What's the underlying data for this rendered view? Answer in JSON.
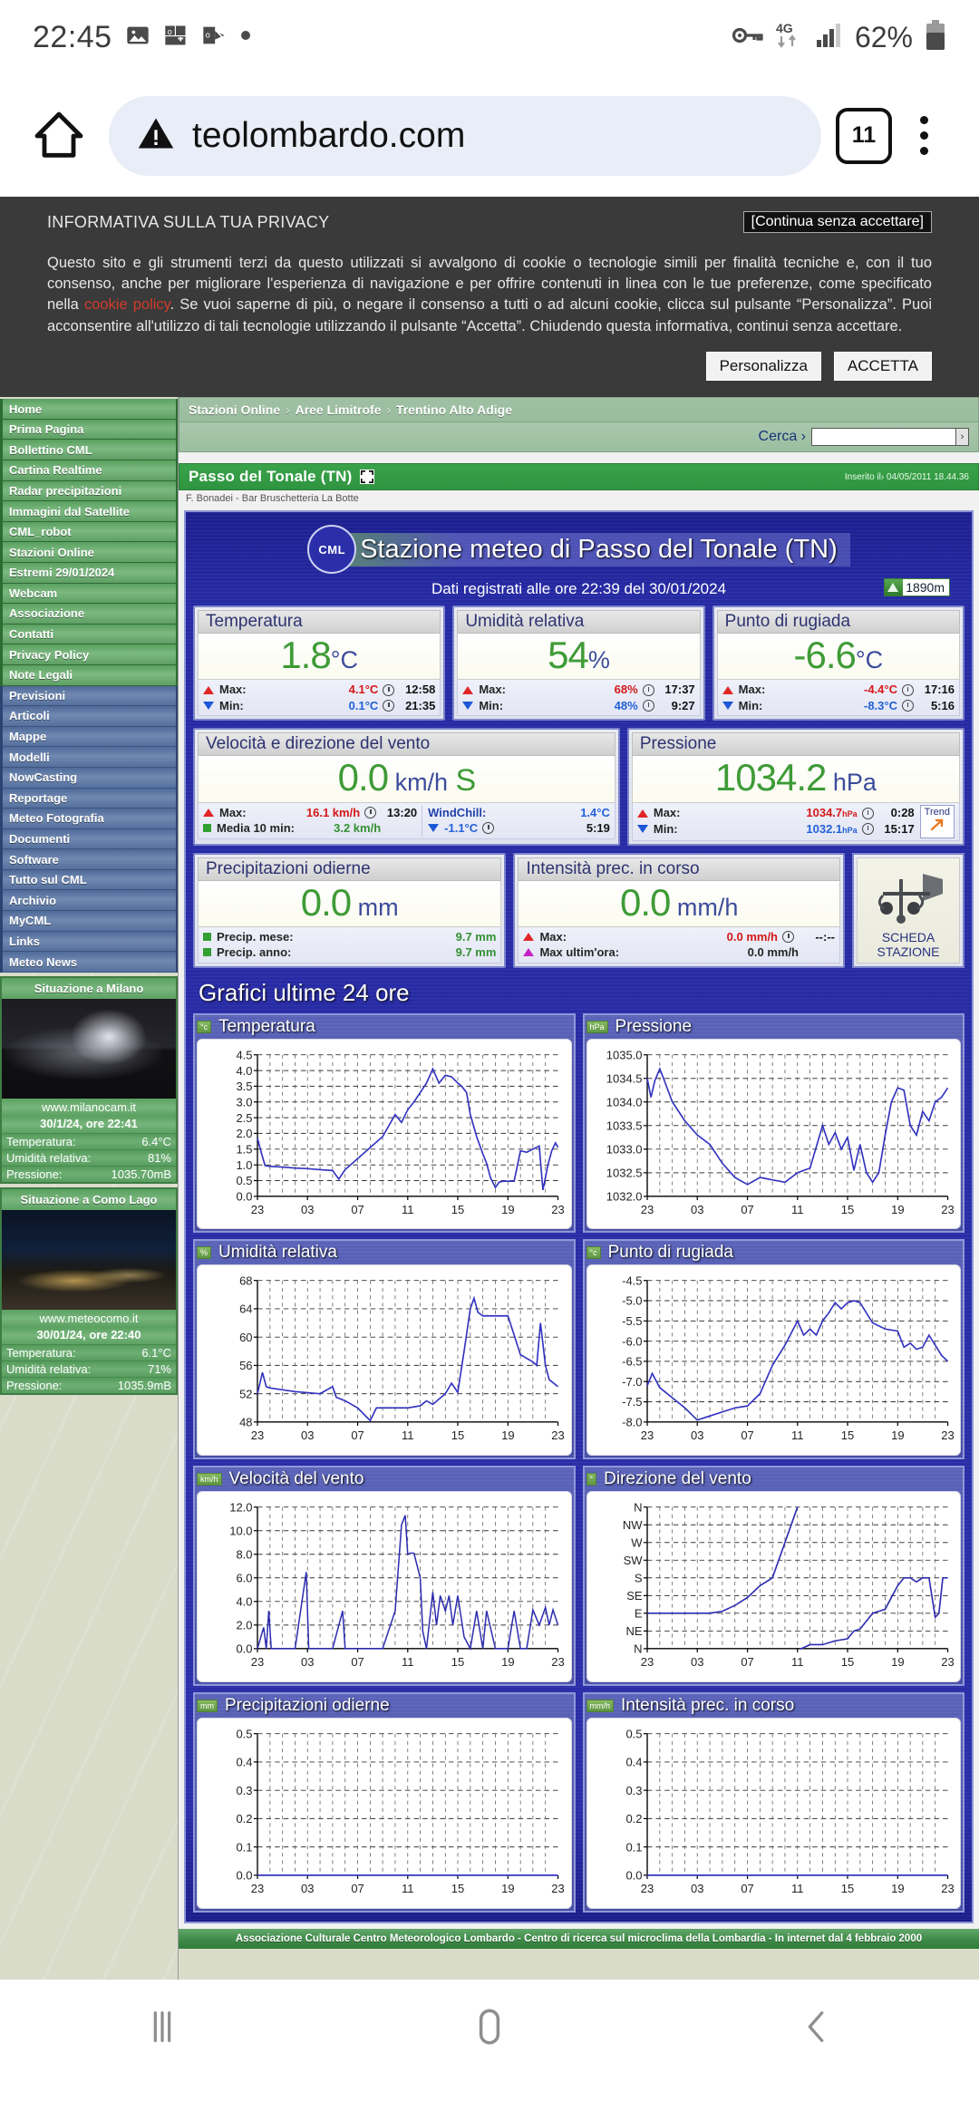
{
  "status_bar": {
    "time": "22:45",
    "icons": [
      "image-icon",
      "office-icon",
      "outlook-icon",
      "dot-icon"
    ],
    "right_icons": [
      "vpn-key-icon",
      "4g-data-icon",
      "signal-bars-icon"
    ],
    "battery_percent": "62%",
    "network_label": "4G"
  },
  "browser": {
    "home_icon": "home-icon",
    "security_icon": "not-secure-warning-icon",
    "url": "teolombardo.com",
    "tab_count": "11",
    "menu_icon": "overflow-menu-icon"
  },
  "privacy_banner": {
    "title": "INFORMATIVA SULLA TUA PRIVACY",
    "continue_button": "[Continua senza accettare]",
    "body_1": "Questo sito e gli strumenti terzi da questo utilizzati si avvalgono di cookie o tecnologie simili per finalità tecniche e, con il tuo consenso, anche per migliorare l'esperienza di navigazione e per offrire contenuti in linea con le tue preferenze, come specificato nella ",
    "policy_link": "cookie policy",
    "body_2": ". Se vuoi saperne di più, o negare il consenso a tutti o ad alcuni cookie, clicca sul pulsante “Personalizza”. Puoi acconsentire all'utilizzo di tali tecnologie utilizzando il pulsante “Accetta”. Chiudendo questa informativa, continui senza accettare.",
    "customize_button": "Personalizza",
    "accept_button": "ACCETTA"
  },
  "sidebar": {
    "green_items": [
      "Home",
      "Prima Pagina",
      "Bollettino CML",
      "Cartina Realtime",
      "Radar precipitazioni",
      "Immagini dal Satellite",
      "CML_robot",
      "Stazioni Online",
      "Estremi 29/01/2024",
      "Webcam",
      "Associazione",
      "Contatti",
      "Privacy Policy",
      "Note Legali"
    ],
    "blue_items": [
      "Previsioni",
      "Articoli",
      "Mappe",
      "Modelli",
      "NowCasting",
      "Reportage",
      "Meteo Fotografia",
      "Documenti",
      "Software",
      "Tutto sul CML",
      "Archivio",
      "MyCML",
      "Links",
      "Meteo News"
    ],
    "cams": [
      {
        "title": "Situazione a Milano",
        "url": "www.milanocam.it",
        "date": "30/1/24, ore 22:41",
        "rows": [
          {
            "label": "Temperatura:",
            "value": "6.4°C"
          },
          {
            "label": "Umidità relativa:",
            "value": "81%"
          },
          {
            "label": "Pressione:",
            "value": "1035.70mB"
          }
        ]
      },
      {
        "title": "Situazione a Como Lago",
        "url": "www.meteocomo.it",
        "date": "30/01/24, ore 22:40",
        "rows": [
          {
            "label": "Temperatura:",
            "value": "6.1°C"
          },
          {
            "label": "Umidità relativa:",
            "value": "71%"
          },
          {
            "label": "Pressione:",
            "value": "1035.9mB"
          }
        ]
      }
    ]
  },
  "breadcrumbs": [
    "Stazioni Online",
    "Aree Limitrofe",
    "Trentino Alto Adige"
  ],
  "search": {
    "label": "Cerca ›",
    "value": "",
    "placeholder": "",
    "go": "›"
  },
  "station_bar": {
    "name": "Passo del Tonale (TN)",
    "fullscreen_icon": "fullscreen-icon",
    "inserted": "Inserito il› 04/05/2011 18.44.36",
    "caption": "F. Bonadei - Bar Bruschetteria La Botte"
  },
  "weather": {
    "logo_text": "CML",
    "title": "Stazione meteo di Passo del Tonale (TN)",
    "subtitle": "Dati registrati alle ore 22:39 del 30/01/2024",
    "altitude": "1890m",
    "cards": [
      {
        "title": "Temperatura",
        "value": "1.8",
        "unit": "°C",
        "rows": [
          {
            "marker": "up",
            "label": "Max:",
            "value": "4.1°C",
            "value_class": "red",
            "time": "12:58"
          },
          {
            "marker": "down",
            "label": "Min:",
            "value": "0.1°C",
            "value_class": "blue",
            "time": "21:35"
          }
        ]
      },
      {
        "title": "Umidità relativa",
        "value": "54",
        "unit": "%",
        "rows": [
          {
            "marker": "up",
            "label": "Max:",
            "value": "68%",
            "value_class": "red",
            "time": "17:37"
          },
          {
            "marker": "down",
            "label": "Min:",
            "value": "48%",
            "value_class": "blue",
            "time": "9:27"
          }
        ]
      },
      {
        "title": "Punto di rugiada",
        "value": "-6.6",
        "unit": "°C",
        "rows": [
          {
            "marker": "up",
            "label": "Max:",
            "value": "-4.4°C",
            "value_class": "red",
            "time": "17:16"
          },
          {
            "marker": "down",
            "label": "Min:",
            "value": "-8.3°C",
            "value_class": "blue",
            "time": "5:16"
          }
        ]
      }
    ],
    "wind": {
      "title": "Velocità e direzione del vento",
      "value": "0.0",
      "unit": "km/h",
      "direction": "S",
      "rows": [
        {
          "marker": "up",
          "label": "Max:",
          "value": "16.1 km/h",
          "value_class": "red",
          "time": "13:20"
        },
        {
          "marker": "sq",
          "label": "Media 10 min:",
          "value": "3.2 km/h",
          "value_class": "green",
          "time": ""
        }
      ],
      "windchill_label": "WindChill:",
      "windchill_value": "1.4°C",
      "windchill_min": "-1.1°C",
      "windchill_min_time": "5:19"
    },
    "pressure": {
      "title": "Pressione",
      "value": "1034.2",
      "unit": "hPa",
      "rows": [
        {
          "marker": "up",
          "label": "Max:",
          "value": "1034.7",
          "small_unit": "hPa",
          "value_class": "red",
          "time": "0:28"
        },
        {
          "marker": "down",
          "label": "Min:",
          "value": "1032.1",
          "small_unit": "hPa",
          "value_class": "blue",
          "time": "15:17"
        }
      ],
      "trend_label": "Trend",
      "trend_icon": "arrow-up-right-icon"
    },
    "precip_today": {
      "title": "Precipitazioni odierne",
      "value": "0.0",
      "unit": "mm",
      "rows": [
        {
          "marker": "sq",
          "label": "Precip. mese:",
          "value": "9.7 mm",
          "value_class": "green"
        },
        {
          "marker": "sq",
          "label": "Precip. anno:",
          "value": "9.7 mm",
          "value_class": "green"
        }
      ]
    },
    "precip_rate": {
      "title": "Intensità prec. in corso",
      "value": "0.0",
      "unit": "mm/h",
      "rows": [
        {
          "marker": "up",
          "label": "Max:",
          "value": "0.0 mm/h",
          "value_class": "red",
          "time": "--:--"
        },
        {
          "marker": "mag",
          "label": "Max ultim'ora:",
          "value": "0.0 mm/h",
          "value_class": "mag"
        }
      ]
    },
    "station_card": {
      "icon": "anemometer-icon",
      "line1": "SCHEDA",
      "line2": "STAZIONE"
    }
  },
  "charts_title": "Grafici ultime 24 ore",
  "chart_data": [
    {
      "type": "line",
      "title": "Temperatura",
      "ylabel": "°c",
      "xlabel": "",
      "yticks": [
        "0.0",
        "0.5",
        "1.0",
        "1.5",
        "2.0",
        "2.5",
        "3.0",
        "3.5",
        "4.0",
        "4.5"
      ],
      "xticks": [
        "23",
        "03",
        "07",
        "11",
        "15",
        "19",
        "23"
      ],
      "ylim": [
        0.0,
        4.5
      ],
      "xlim": [
        23,
        47
      ],
      "grid": true,
      "legend": "none",
      "x": [
        23,
        23.3,
        23.6,
        24,
        25,
        26,
        27,
        28,
        29,
        29.5,
        30,
        31,
        32,
        33,
        34,
        34.5,
        35,
        35.5,
        36,
        36.5,
        37,
        37.5,
        38,
        38.5,
        39,
        39.3,
        39.7,
        40,
        40.5,
        41,
        41.3,
        41.6,
        42,
        42.3,
        42.6,
        43,
        43.5,
        44,
        44.5,
        45,
        45.5,
        45.8,
        46,
        46.2,
        46.5,
        46.8,
        47
      ],
      "values": [
        1.85,
        1.4,
        0.98,
        0.95,
        0.93,
        0.9,
        0.88,
        0.85,
        0.82,
        0.55,
        0.85,
        1.2,
        1.55,
        1.9,
        2.6,
        2.35,
        2.75,
        3.0,
        3.3,
        3.6,
        4.05,
        3.6,
        3.85,
        3.8,
        3.6,
        3.5,
        3.3,
        2.6,
        1.9,
        1.35,
        1.05,
        0.6,
        0.28,
        0.45,
        0.48,
        0.48,
        0.48,
        1.45,
        1.4,
        1.5,
        1.6,
        0.2,
        0.6,
        1.0,
        1.45,
        1.7,
        1.55
      ]
    },
    {
      "type": "line",
      "title": "Pressione",
      "ylabel": "hPa",
      "xlabel": "",
      "yticks": [
        "1032.0",
        "1032.5",
        "1033.0",
        "1033.5",
        "1034.0",
        "1034.5",
        "1035.0"
      ],
      "xticks": [
        "23",
        "03",
        "07",
        "11",
        "15",
        "19",
        "23"
      ],
      "ylim": [
        1032.0,
        1035.0
      ],
      "xlim": [
        23,
        47
      ],
      "grid": true,
      "legend": "none",
      "x": [
        23,
        23.3,
        23.6,
        24,
        24.3,
        25,
        26,
        27,
        28,
        29,
        30,
        31,
        32,
        33,
        34,
        35,
        36,
        37,
        37.5,
        38,
        38.5,
        39,
        39.5,
        40,
        40.5,
        41,
        41.5,
        42,
        42.5,
        43,
        43.5,
        44,
        44.5,
        45,
        45.5,
        46,
        46.5,
        47
      ],
      "values": [
        1034.5,
        1034.1,
        1034.45,
        1034.7,
        1034.5,
        1034.0,
        1033.6,
        1033.3,
        1033.1,
        1032.7,
        1032.4,
        1032.25,
        1032.4,
        1032.35,
        1032.3,
        1032.5,
        1032.6,
        1033.5,
        1033.1,
        1033.35,
        1033.0,
        1033.25,
        1032.55,
        1033.1,
        1032.5,
        1032.3,
        1032.5,
        1033.3,
        1034.0,
        1034.3,
        1034.25,
        1033.5,
        1033.3,
        1033.8,
        1033.6,
        1034.0,
        1034.1,
        1034.3
      ]
    },
    {
      "type": "line",
      "title": "Umidità relativa",
      "ylabel": "%",
      "xlabel": "",
      "yticks": [
        "48",
        "52",
        "56",
        "60",
        "64",
        "68"
      ],
      "xticks": [
        "23",
        "03",
        "07",
        "11",
        "15",
        "19",
        "23"
      ],
      "ylim": [
        48,
        68
      ],
      "xlim": [
        23,
        47
      ],
      "grid": true,
      "legend": "none",
      "x": [
        23,
        23.4,
        23.7,
        24,
        26,
        28,
        29,
        29.3,
        30,
        31,
        32,
        32.5,
        33,
        35,
        36,
        36.5,
        37,
        38,
        38.5,
        39,
        39.5,
        40,
        40.3,
        40.6,
        41,
        42,
        43,
        44,
        45,
        45.3,
        45.6,
        46,
        46.3,
        47
      ],
      "values": [
        52,
        55,
        53,
        52.8,
        52.3,
        52,
        53,
        51.5,
        51,
        50,
        48.2,
        50,
        50,
        50,
        50.3,
        51,
        50.5,
        52,
        53.5,
        52.2,
        58,
        64,
        65.5,
        63.5,
        63,
        63,
        63,
        57.5,
        56.5,
        56,
        62,
        56,
        54,
        53
      ]
    },
    {
      "type": "line",
      "title": "Punto di rugiada",
      "ylabel": "°c",
      "xlabel": "",
      "yticks": [
        "-8.0",
        "-7.5",
        "-7.0",
        "-6.5",
        "-6.0",
        "-5.5",
        "-5.0",
        "-4.5"
      ],
      "xticks": [
        "23",
        "03",
        "07",
        "11",
        "15",
        "19",
        "23"
      ],
      "ylim": [
        -8.0,
        -4.5
      ],
      "xlim": [
        23,
        47
      ],
      "grid": true,
      "legend": "none",
      "x": [
        23,
        23.4,
        24,
        25,
        26,
        27,
        28,
        29,
        30,
        31,
        32,
        33,
        34,
        35,
        35.5,
        36,
        36.5,
        37,
        37.5,
        38,
        38.5,
        39,
        39.5,
        40,
        41,
        42,
        43,
        43.5,
        44,
        44.5,
        45,
        45.5,
        46,
        46.5,
        47
      ],
      "values": [
        -7.1,
        -6.8,
        -7.15,
        -7.4,
        -7.65,
        -7.95,
        -7.85,
        -7.75,
        -7.65,
        -7.6,
        -7.3,
        -6.6,
        -6.1,
        -5.5,
        -5.85,
        -5.7,
        -5.85,
        -5.5,
        -5.3,
        -5.05,
        -5.2,
        -5.05,
        -5.0,
        -5.05,
        -5.55,
        -5.7,
        -5.75,
        -6.15,
        -6.05,
        -6.2,
        -6.15,
        -5.85,
        -6.1,
        -6.35,
        -6.5
      ]
    },
    {
      "type": "line",
      "title": "Velocità del vento",
      "ylabel": "km/h",
      "xlabel": "",
      "yticks": [
        "0.0",
        "2.0",
        "4.0",
        "6.0",
        "8.0",
        "10.0",
        "12.0"
      ],
      "xticks": [
        "23",
        "03",
        "07",
        "11",
        "15",
        "19",
        "23"
      ],
      "ylim": [
        0.0,
        12.0
      ],
      "xlim": [
        23,
        47
      ],
      "grid": true,
      "legend": "none",
      "x": [
        23,
        23.5,
        23.7,
        23.9,
        24.1,
        24.3,
        25,
        26,
        26.9,
        27.1,
        28,
        29,
        29.8,
        30,
        31,
        32,
        33,
        34,
        34.5,
        34.8,
        35,
        35.2,
        35.5,
        36,
        36.2,
        36.5,
        37,
        37.3,
        37.6,
        38,
        38.3,
        38.6,
        39,
        39.5,
        40,
        40.5,
        41,
        41.3,
        42,
        42.5,
        43,
        43.5,
        44,
        44.5,
        45,
        45.5,
        46,
        46.3,
        46.6,
        47
      ],
      "values": [
        0,
        1.8,
        0,
        3.2,
        0,
        0,
        0,
        0,
        6.5,
        0,
        0,
        0,
        3.2,
        0,
        0,
        0,
        0,
        3.2,
        10.5,
        11.3,
        8.0,
        8.1,
        8.1,
        6.0,
        1.5,
        0,
        4.8,
        2.0,
        4.5,
        3.2,
        4.5,
        2.0,
        4.5,
        1.0,
        0,
        3.2,
        0,
        3.2,
        0,
        0,
        0,
        3.2,
        0,
        0,
        3.3,
        2.0,
        3.5,
        2.0,
        3.3,
        2.0
      ]
    },
    {
      "type": "line",
      "title": "Direzione del vento",
      "ylabel": "°",
      "xlabel": "",
      "yticks": [
        "N",
        "NE",
        "E",
        "SE",
        "S",
        "SW",
        "W",
        "NW",
        "N"
      ],
      "xticks": [
        "23",
        "03",
        "07",
        "11",
        "15",
        "19",
        "23"
      ],
      "ylim": [
        0,
        360
      ],
      "xlim": [
        23,
        47
      ],
      "grid": true,
      "legend": "none",
      "x": [
        23,
        23.5,
        24,
        26,
        28,
        29,
        30,
        31,
        32,
        33,
        34,
        35,
        35.2,
        35.3,
        36,
        37,
        38,
        39,
        39.5,
        40,
        41,
        42,
        42.5,
        43,
        43.5,
        44,
        44.5,
        45,
        45.5,
        46,
        46.3,
        46.6,
        47
      ],
      "values": [
        90,
        90,
        90,
        90,
        90,
        95,
        110,
        130,
        160,
        180,
        270,
        360,
        0,
        0,
        10,
        10,
        20,
        25,
        45,
        50,
        90,
        100,
        130,
        160,
        180,
        180,
        170,
        180,
        180,
        80,
        90,
        180,
        180
      ]
    },
    {
      "type": "line",
      "title": "Precipitazioni odierne",
      "ylabel": "mm",
      "xlabel": "",
      "yticks": [
        "0.0",
        "0.1",
        "0.2",
        "0.3",
        "0.4",
        "0.5"
      ],
      "xticks": [
        "23",
        "03",
        "07",
        "11",
        "15",
        "19",
        "23"
      ],
      "ylim": [
        0.0,
        0.5
      ],
      "xlim": [
        23,
        47
      ],
      "grid": true,
      "legend": "none",
      "x": [
        23,
        47
      ],
      "values": [
        0.0,
        0.0
      ]
    },
    {
      "type": "line",
      "title": "Intensità prec. in corso",
      "ylabel": "mm/h",
      "xlabel": "",
      "yticks": [
        "0.0",
        "0.1",
        "0.2",
        "0.3",
        "0.4",
        "0.5"
      ],
      "xticks": [
        "23",
        "03",
        "07",
        "11",
        "15",
        "19",
        "23"
      ],
      "ylim": [
        0.0,
        0.5
      ],
      "xlim": [
        23,
        47
      ],
      "grid": true,
      "legend": "none",
      "x": [
        23,
        47
      ],
      "values": [
        0.0,
        0.0
      ]
    }
  ],
  "footer": "Associazione Culturale Centro Meteorologico Lombardo - Centro di ricerca sul microclima della Lombardia - In internet dal 4 febbraio 2000",
  "nav_bar": {
    "recents_icon": "recents-icon",
    "home_icon": "home-circle-icon",
    "back_icon": "back-chevron-icon"
  }
}
